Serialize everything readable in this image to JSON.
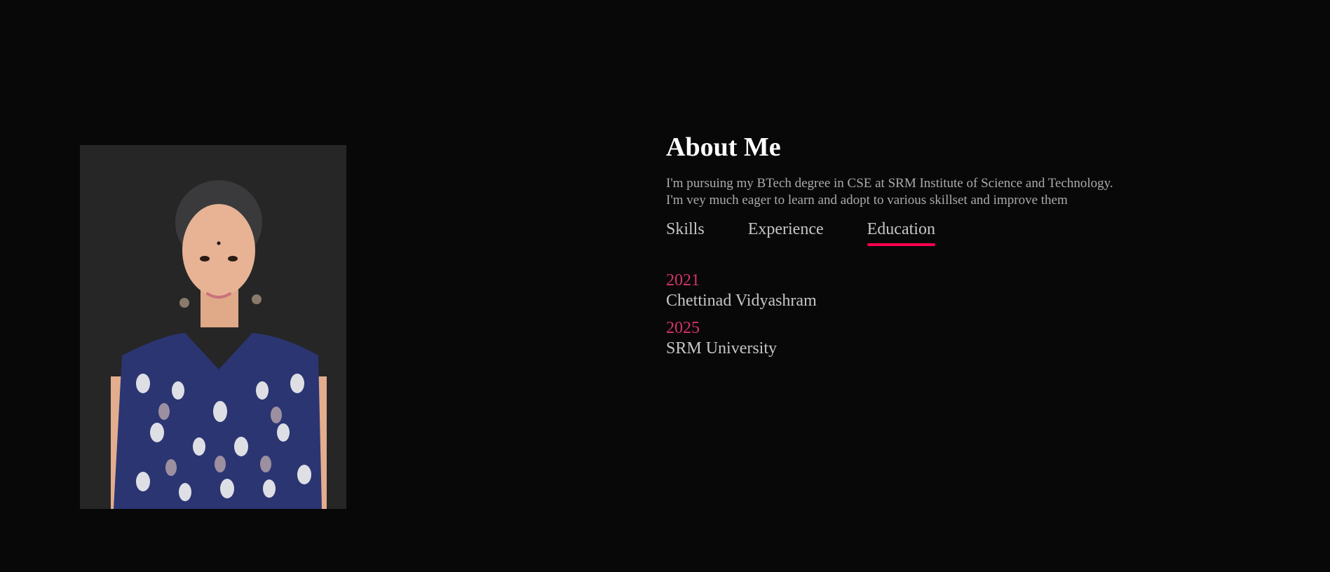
{
  "colors": {
    "background": "#080808",
    "accent": "#ff004f",
    "year": "#d6336c",
    "text": "#ababab",
    "heading": "#ffffff"
  },
  "profile_photo": {
    "icon": "portrait-photo"
  },
  "about": {
    "title": "About Me",
    "lines": [
      "I'm pursuing my BTech degree in CSE at SRM Institute of Science and Technology.",
      "I'm vey much eager to learn and adopt to various skillset and improve them"
    ]
  },
  "tabs": [
    {
      "label": "Skills",
      "active": false
    },
    {
      "label": "Experience",
      "active": false
    },
    {
      "label": "Education",
      "active": true
    }
  ],
  "education": [
    {
      "year": "2021",
      "school": "Chettinad Vidyashram"
    },
    {
      "year": "2025",
      "school": "SRM University"
    }
  ]
}
